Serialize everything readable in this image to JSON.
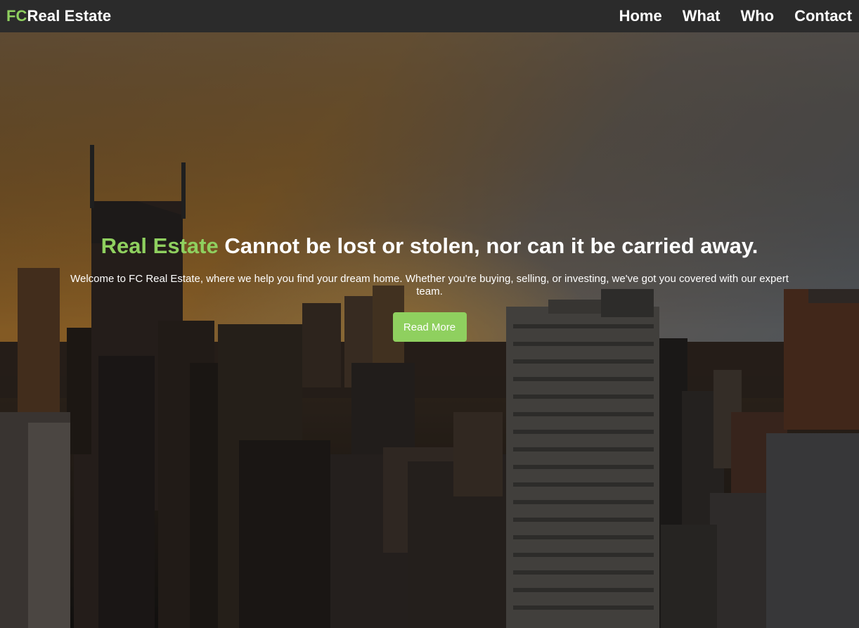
{
  "nav": {
    "brand_accent": "FC",
    "brand_rest": "Real Estate",
    "links": [
      "Home",
      "What",
      "Who",
      "Contact"
    ]
  },
  "hero": {
    "title_accent": "Real Estate",
    "title_rest": " Cannot be lost or stolen, nor can it be carried away.",
    "text": "Welcome to FC Real Estate, where we help you find your dream home. Whether you're buying, selling, or investing, we've got you covered with our expert team.",
    "button_label": "Read More",
    "background_image": "city-skyline-sunset-photo"
  },
  "colors": {
    "accent": "#8fd05f",
    "navbar": "#2b2b2b",
    "text": "#ffffff"
  }
}
